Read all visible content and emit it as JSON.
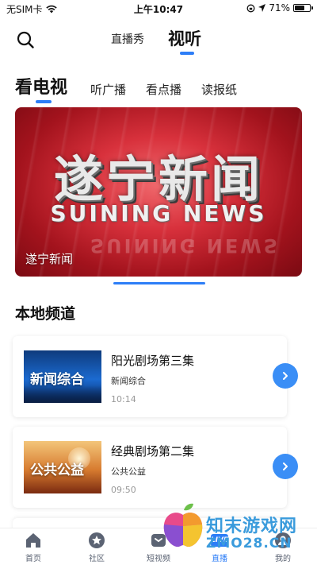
{
  "status_bar": {
    "carrier": "无SIM卡",
    "time": "上午10:47",
    "battery": "71%",
    "battery_level": 0.71
  },
  "header": {
    "tabs": [
      {
        "label": "直播秀",
        "active": false
      },
      {
        "label": "视听",
        "active": true
      }
    ]
  },
  "sub_tabs": [
    {
      "label": "看电视",
      "active": true
    },
    {
      "label": "听广播",
      "active": false
    },
    {
      "label": "看点播",
      "active": false
    },
    {
      "label": "读报纸",
      "active": false
    }
  ],
  "banner": {
    "title": "遂宁新闻",
    "subtitle": "SUINING NEWS",
    "reflection": "SUINING NEWS",
    "caption": "遂宁新闻"
  },
  "section": {
    "title": "本地频道"
  },
  "channels": [
    {
      "thumb_text": "新闻综合",
      "title": "阳光剧场第三集",
      "channel": "新闻综合",
      "time": "10:14"
    },
    {
      "thumb_text": "公共公益",
      "title": "经典剧场第二集",
      "channel": "公共公益",
      "time": "09:50"
    }
  ],
  "bottom_nav": [
    {
      "label": "首页",
      "icon": "home-icon",
      "active": false
    },
    {
      "label": "社区",
      "icon": "star-icon",
      "active": false
    },
    {
      "label": "短视频",
      "icon": "video-icon",
      "active": false
    },
    {
      "label": "直播",
      "icon": "live-icon",
      "badge": "LIVE",
      "active": true
    },
    {
      "label": "我的",
      "icon": "profile-icon",
      "active": false
    }
  ],
  "watermark": {
    "line1": "知末游戏网",
    "line2": "ZMO28.CN"
  },
  "colors": {
    "accent": "#2d7ef7",
    "banner_red": "#d8313c",
    "watermark": "#3a9bdc"
  }
}
